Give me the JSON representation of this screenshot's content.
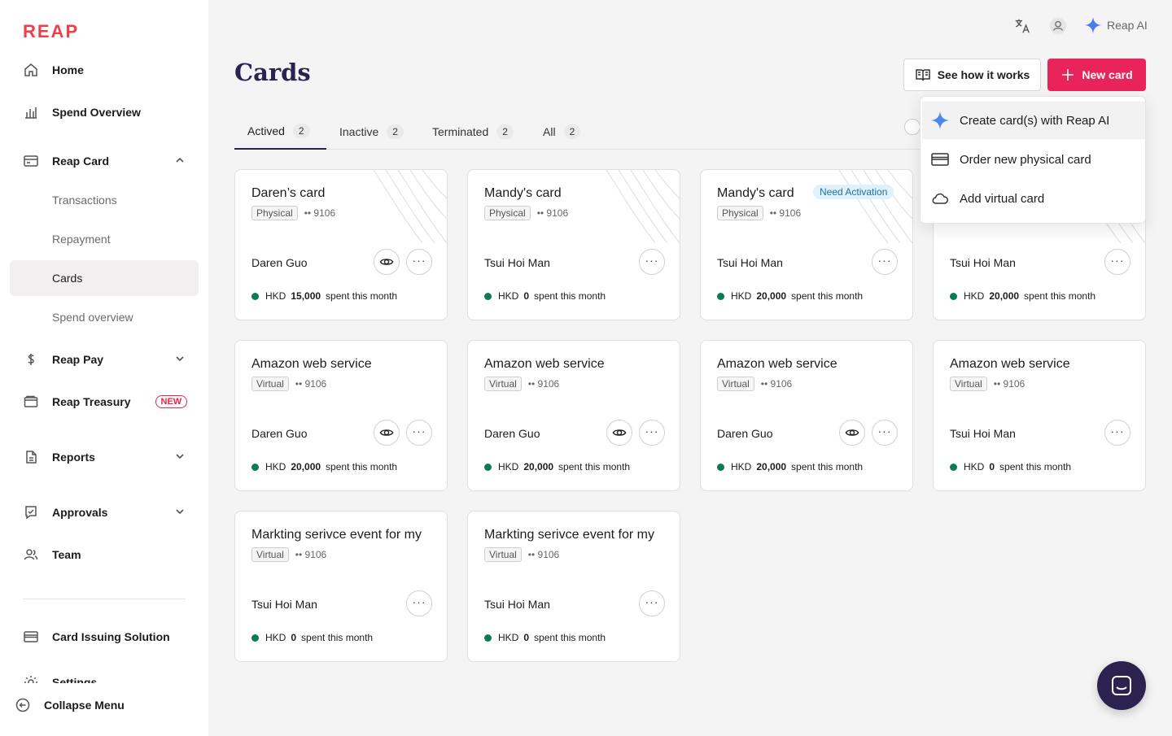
{
  "brand": {
    "logo": "REAP",
    "accent": "#e9245a",
    "dark": "#2c2250"
  },
  "sidebar": {
    "items": [
      {
        "label": "Home"
      },
      {
        "label": "Spend Overview"
      },
      {
        "label": "Reap Card"
      },
      {
        "label": "Transactions"
      },
      {
        "label": "Repayment"
      },
      {
        "label": "Cards"
      },
      {
        "label": "Spend overview"
      },
      {
        "label": "Reap Pay"
      },
      {
        "label": "Reap Treasury",
        "badge": "NEW"
      },
      {
        "label": "Reports"
      },
      {
        "label": "Approvals"
      },
      {
        "label": "Team"
      },
      {
        "label": "Card Issuing Solution"
      },
      {
        "label": "Settings"
      }
    ],
    "collapse_label": "Collapse Menu"
  },
  "header": {
    "reap_ai_label": "Reap AI",
    "title": "Cards",
    "see_how_label": "See how it works",
    "new_card_label": "New card"
  },
  "tabs": [
    {
      "label": "Actived",
      "count": "2"
    },
    {
      "label": "Inactive",
      "count": "2"
    },
    {
      "label": "Terminated",
      "count": "2"
    },
    {
      "label": "All",
      "count": "2"
    }
  ],
  "dropdown": {
    "items": [
      {
        "label": "Create card(s) with Reap AI"
      },
      {
        "label": "Order new physical card"
      },
      {
        "label": "Add virtual card"
      }
    ]
  },
  "cards": [
    {
      "title": "Daren’s card",
      "type": "Physical",
      "last4": "•• 9106",
      "holder": "Daren Guo",
      "currency": "HKD",
      "amount": "15,000",
      "spent_suffix": "spent this month"
    },
    {
      "title": "Mandy's card",
      "type": "Physical",
      "last4": "•• 9106",
      "holder": "Tsui Hoi Man",
      "currency": "HKD",
      "amount": "0",
      "spent_suffix": "spent this month"
    },
    {
      "title": "Mandy's card",
      "type": "Physical",
      "last4": "•• 9106",
      "holder": "Tsui Hoi Man",
      "currency": "HKD",
      "amount": "20,000",
      "spent_suffix": "spent this month",
      "status": "Need Activation"
    },
    {
      "holder": "Tsui Hoi Man",
      "currency": "HKD",
      "amount": "20,000",
      "spent_suffix": "spent this month"
    },
    {
      "title": "Amazon web service",
      "type": "Virtual",
      "last4": "•• 9106",
      "holder": "Daren Guo",
      "currency": "HKD",
      "amount": "20,000",
      "spent_suffix": "spent this month"
    },
    {
      "title": "Amazon web service",
      "type": "Virtual",
      "last4": "•• 9106",
      "holder": "Daren Guo",
      "currency": "HKD",
      "amount": "20,000",
      "spent_suffix": "spent this month"
    },
    {
      "title": "Amazon web service",
      "type": "Virtual",
      "last4": "•• 9106",
      "holder": "Daren Guo",
      "currency": "HKD",
      "amount": "20,000",
      "spent_suffix": "spent this month"
    },
    {
      "title": "Amazon web service",
      "type": "Virtual",
      "last4": "•• 9106",
      "holder": "Tsui Hoi Man",
      "currency": "HKD",
      "amount": "0",
      "spent_suffix": "spent this month"
    },
    {
      "title": "Markting serivce event for my",
      "type": "Virtual",
      "last4": "•• 9106",
      "holder": "Tsui Hoi Man",
      "currency": "HKD",
      "amount": "0",
      "spent_suffix": "spent this month"
    },
    {
      "title": "Markting serivce event for my",
      "type": "Virtual",
      "last4": "•• 9106",
      "holder": "Tsui Hoi Man",
      "currency": "HKD",
      "amount": "0",
      "spent_suffix": "spent this month"
    }
  ]
}
